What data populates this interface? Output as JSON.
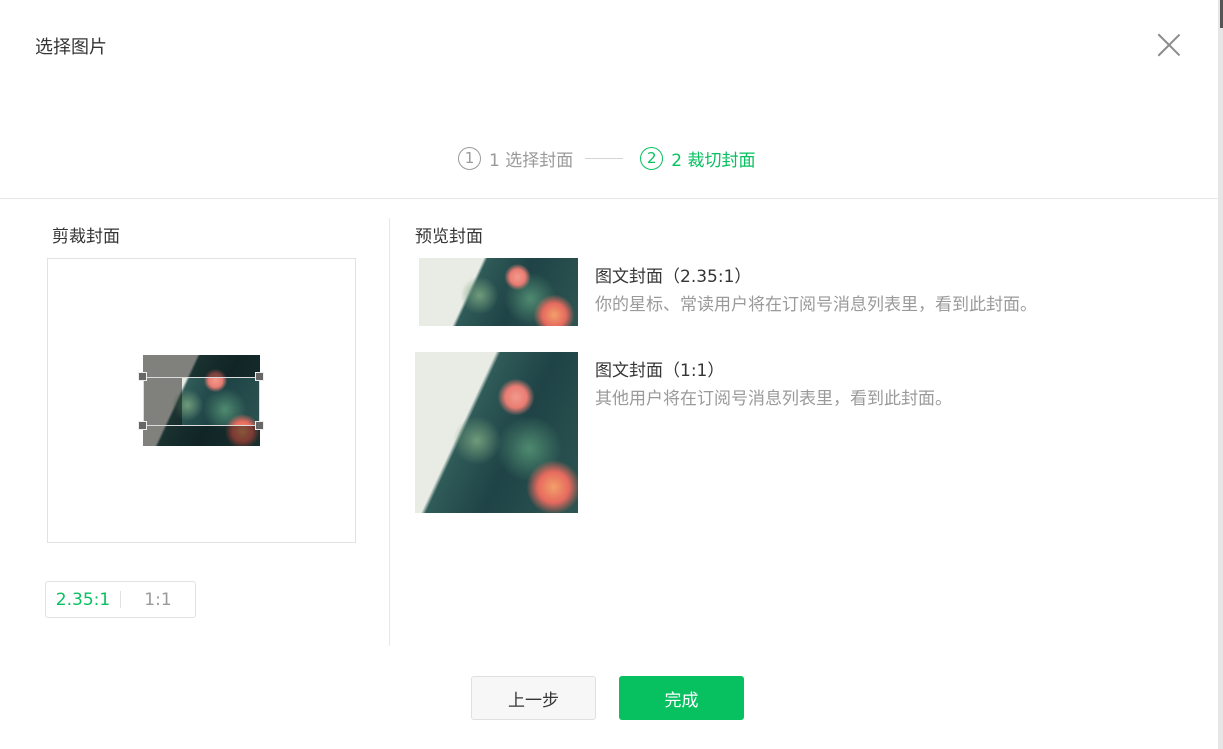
{
  "dialog": {
    "title": "选择图片",
    "close_icon": "close-icon"
  },
  "steps": [
    {
      "num": "1",
      "label": "1 选择封面",
      "active": false
    },
    {
      "num": "2",
      "label": "2 裁切封面",
      "active": true
    }
  ],
  "crop_panel": {
    "title": "剪裁封面",
    "ratios": [
      {
        "label": "2.35:1",
        "active": true
      },
      {
        "label": "1:1",
        "active": false
      }
    ]
  },
  "preview_panel": {
    "title": "预览封面",
    "items": [
      {
        "label": "图文封面（2.35:1）",
        "desc": "你的星标、常读用户将在订阅号消息列表里，看到此封面。"
      },
      {
        "label": "图文封面（1:1）",
        "desc": "其他用户将在订阅号消息列表里，看到此封面。"
      }
    ]
  },
  "footer": {
    "prev_label": "上一步",
    "done_label": "完成"
  },
  "colors": {
    "accent": "#07c160",
    "muted": "#9a9a9a",
    "text": "#353535"
  }
}
